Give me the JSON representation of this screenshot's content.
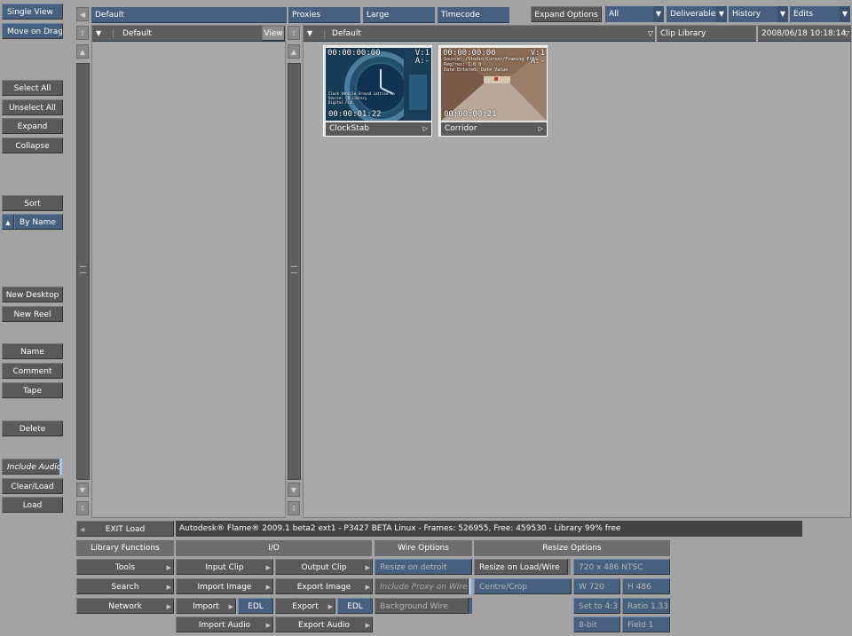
{
  "left_buttons": {
    "single_view": "Single View",
    "move_on_drag": "Move on Drag",
    "select_all": "Select All",
    "unselect_all": "Unselect All",
    "expand": "Expand",
    "collapse": "Collapse",
    "sort": "Sort",
    "by_name": "By Name",
    "new_desktop": "New Desktop",
    "new_reel": "New Reel",
    "name": "Name",
    "comment": "Comment",
    "tape": "Tape",
    "delete": "Delete",
    "include_audio": "Include Audio",
    "clear_load": "Clear/Load",
    "load": "Load"
  },
  "top_bar": {
    "library_name": "Default",
    "proxies": "Proxies",
    "large": "Large",
    "timecode": "Timecode",
    "expand_options": "Expand Options",
    "filter_all": "All",
    "deliverables": "Deliverables",
    "history": "History",
    "edits": "Edits"
  },
  "tree_panel": {
    "title": "Default",
    "view": "View"
  },
  "clip_panel": {
    "title": "Default",
    "library": "Clip Library",
    "datetime": "2008/06/18 10:18:14"
  },
  "clips": [
    {
      "name": "ClockStab",
      "tc_start": "00:00:00:00",
      "tc_end": "00:00:01:22",
      "track": "V:1",
      "audio": "A:-",
      "overlay": [
        "Clock Vehicle Ground Lattice Fo",
        "Source: CB Library",
        "Digital Fid"
      ]
    },
    {
      "name": "Corridor",
      "tc_start": "00:00:00:00",
      "tc_end": "00:00:00:21",
      "track": "V:1",
      "audio": "A:-",
      "overlay": [
        "Source: /Studio/Cursor/Framing Effx",
        "Reg/res: 1.0 0",
        "Date Entered: Date Value"
      ]
    }
  ],
  "status": {
    "exit_load": "EXIT Load",
    "message": "Autodesk® Flame® 2009.1 beta2 ext1 - P3427 BETA Linux - Frames: 526955, Free: 459530 - Library 99% free"
  },
  "bottom": {
    "library_functions": "Library Functions",
    "io": "I/O",
    "wire_options": "Wire Options",
    "resize_options": "Resize Options",
    "tools": "Tools",
    "search": "Search",
    "network": "Network",
    "input_clip": "Input Clip",
    "import_image": "Import Image",
    "import": "Import",
    "edl_in": "EDL",
    "import_audio": "Import Audio",
    "output_clip": "Output Clip",
    "export_image": "Export Image",
    "export": "Export",
    "edl_out": "EDL",
    "export_audio": "Export Audio",
    "resize_on_detroit": "Resize on detroit",
    "include_proxy_on_wire": "Include Proxy on Wire",
    "background_wire": "Background Wire",
    "resize_on_load_wire": "Resize on Load/Wire",
    "centre_crop": "Centre/Crop",
    "resolution": "720 x 486 NTSC",
    "width": "W 720",
    "height": "H 486",
    "set_to_4_3": "Set to 4:3",
    "ratio": "Ratio 1.333",
    "bit_depth": "8-bit",
    "field": "Field 1"
  },
  "colors": {
    "background": "#a3a3a3",
    "button": "#5a5a5a",
    "accent_blue": "#47607f",
    "status_bar": "#434343"
  }
}
